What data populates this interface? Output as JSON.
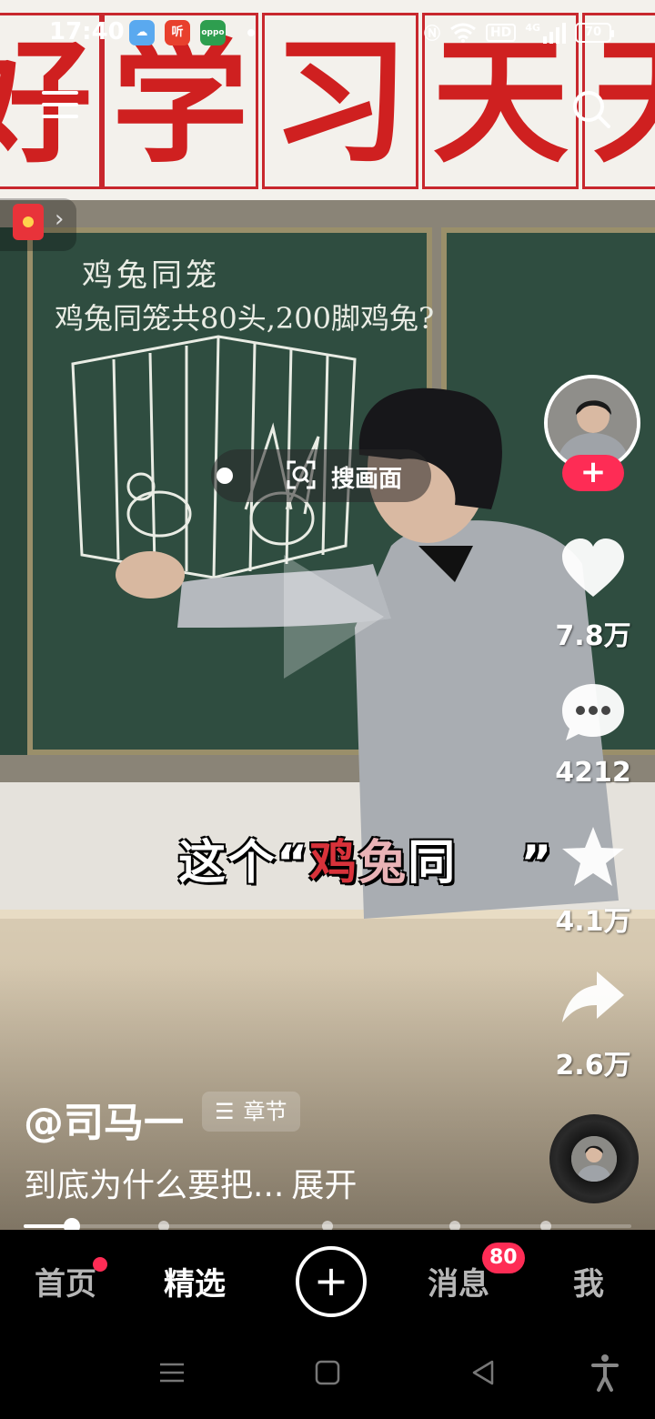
{
  "status_bar": {
    "time": "17:40",
    "apps": [
      {
        "icon": "weather-icon",
        "text": "",
        "color": "#5aa9ef"
      },
      {
        "icon": "ting-app-icon",
        "text": "听",
        "color": "#e8402d"
      },
      {
        "icon": "oppo-app-icon",
        "text": "oppo",
        "color": "#2e9e4f"
      }
    ],
    "network": "HD",
    "signal": "4G",
    "battery": "70"
  },
  "scene": {
    "banner_chars": [
      "好",
      "学",
      "习",
      "天",
      "天"
    ],
    "board_title": "鸡兔同笼",
    "board_question": "鸡兔同笼共80头,200脚鸡兔?"
  },
  "overlay": {
    "search_label": "搜画面",
    "subtitle_quote_open": "“",
    "subtitle_white": "这个",
    "subtitle_red1": "鸡",
    "subtitle_pink": "兔",
    "subtitle_red2": "同",
    "subtitle_quote_close": "”"
  },
  "actions": {
    "likes": "7.8万",
    "comments": "4212",
    "favorites": "4.1万",
    "shares": "2.6万"
  },
  "caption": {
    "author": "@司马一",
    "chapter_label": "章节",
    "description": "到底为什么要把...",
    "expand_label": "展开"
  },
  "progress": {
    "played_fraction": 0.08,
    "chapter_marks": [
      0.23,
      0.5,
      0.71,
      0.86
    ]
  },
  "bottom_nav": {
    "home": "首页",
    "featured": "精选",
    "create": "+",
    "messages": "消息",
    "messages_badge": "80",
    "me": "我"
  },
  "colors": {
    "accent": "#fe2c55",
    "chalkboard": "#2f4d40",
    "banner_red": "#cf2020"
  }
}
